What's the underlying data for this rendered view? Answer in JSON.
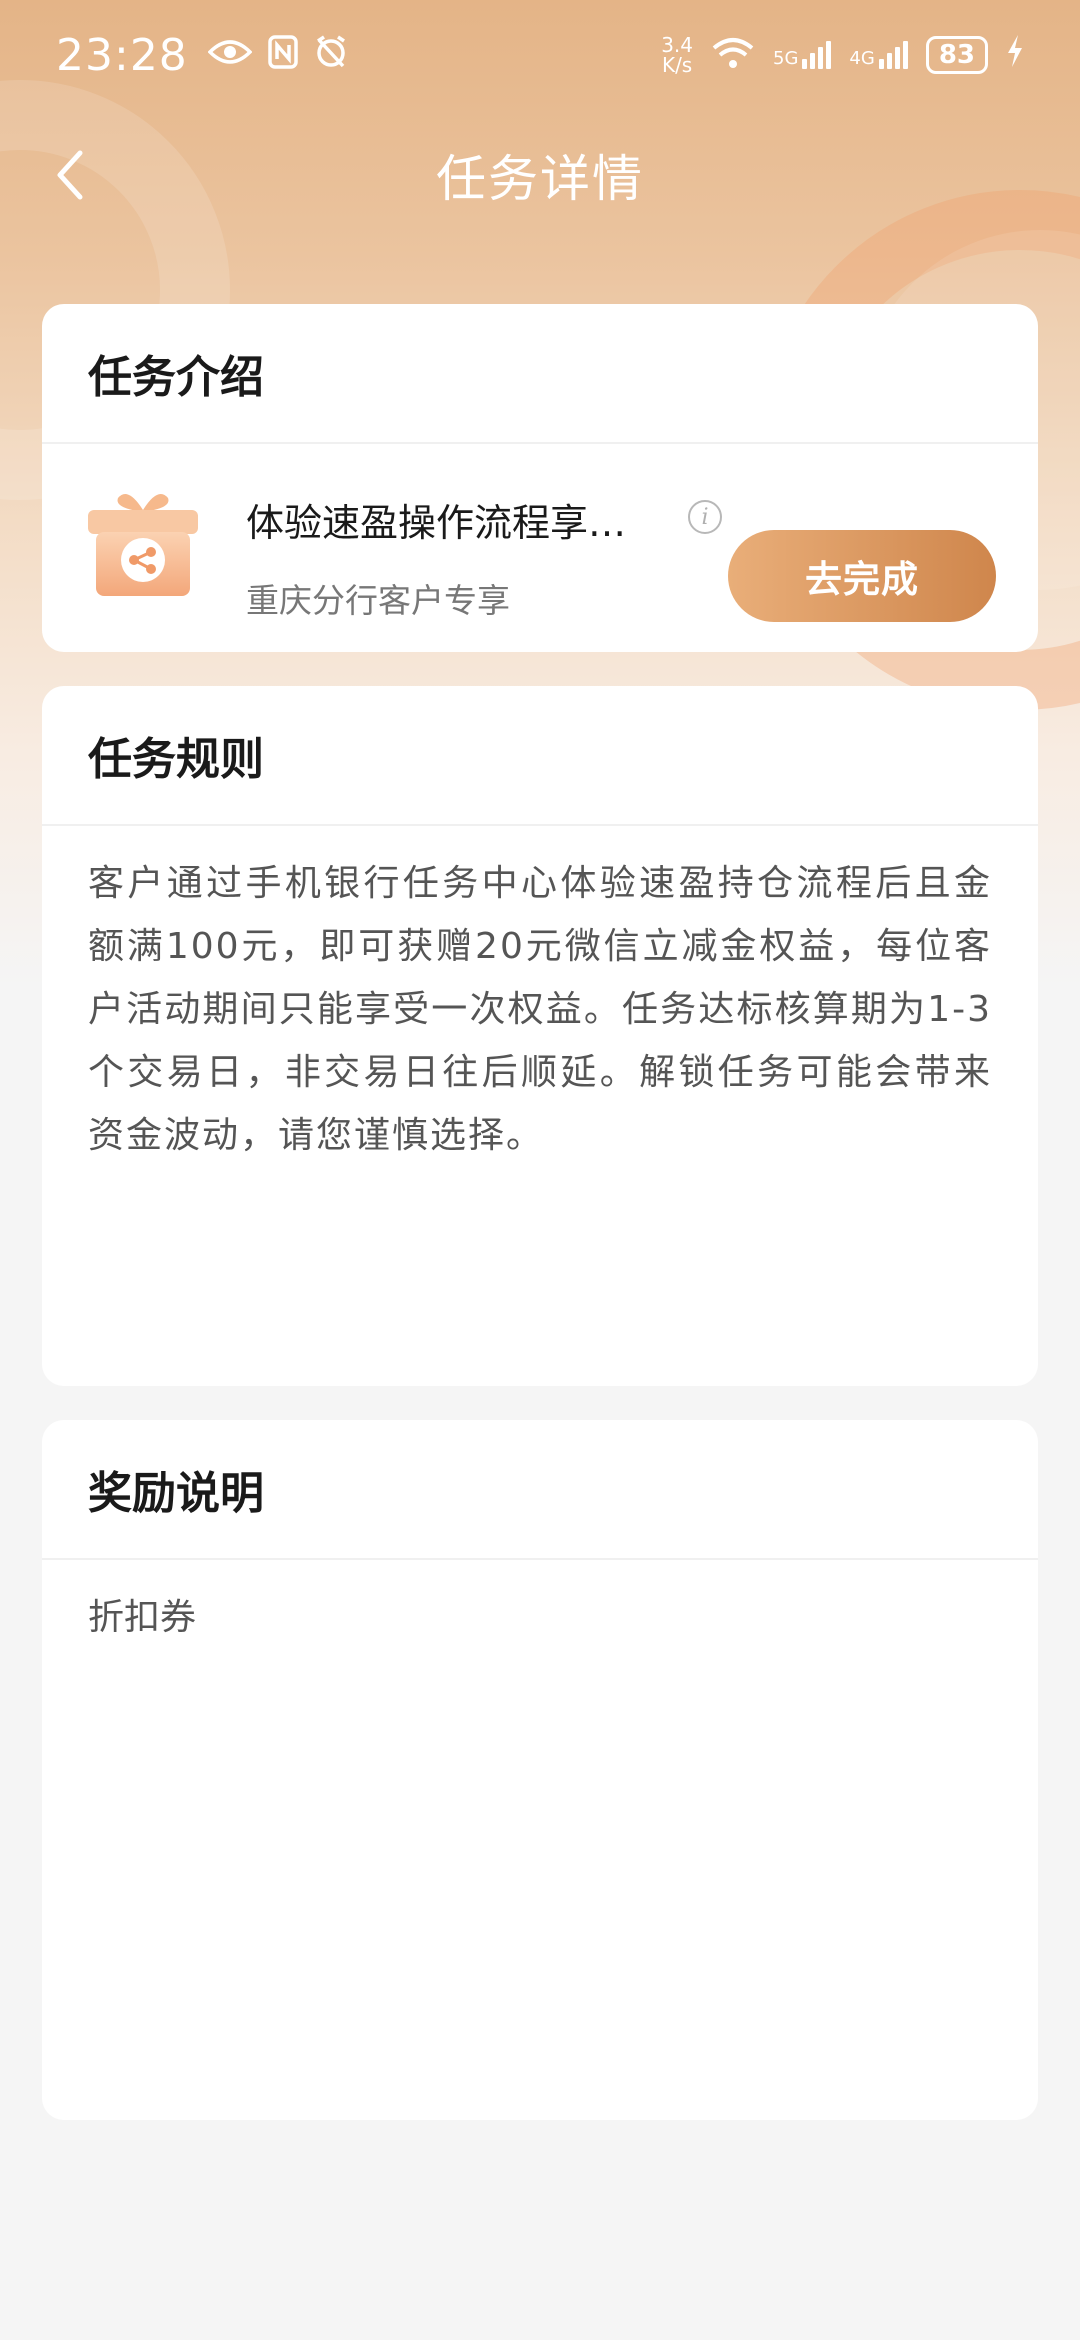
{
  "status_bar": {
    "time": "23:28",
    "net_speed_value": "3.4",
    "net_speed_unit": "K/s",
    "sim1_label": "5G",
    "sim2_label": "4G",
    "battery": "83"
  },
  "nav": {
    "title": "任务详情"
  },
  "intro": {
    "title": "任务介绍",
    "task_name": "体验速盈操作流程享…",
    "task_sub": "重庆分行客户专享",
    "button_label": "去完成"
  },
  "rules": {
    "title": "任务规则",
    "body": "客户通过手机银行任务中心体验速盈持仓流程后且金额满100元，即可获赠20元微信立减金权益，每位客户活动期间只能享受一次权益。任务达标核算期为1-3个交易日，非交易日往后顺延。解锁任务可能会带来资金波动，请您谨慎选择。"
  },
  "reward": {
    "title": "奖励说明",
    "body": "折扣券"
  },
  "colors": {
    "header_gradient_top": "#e4b487",
    "button_start": "#e9ae79",
    "button_end": "#cf864c",
    "page_bg": "#f5f5f5"
  }
}
